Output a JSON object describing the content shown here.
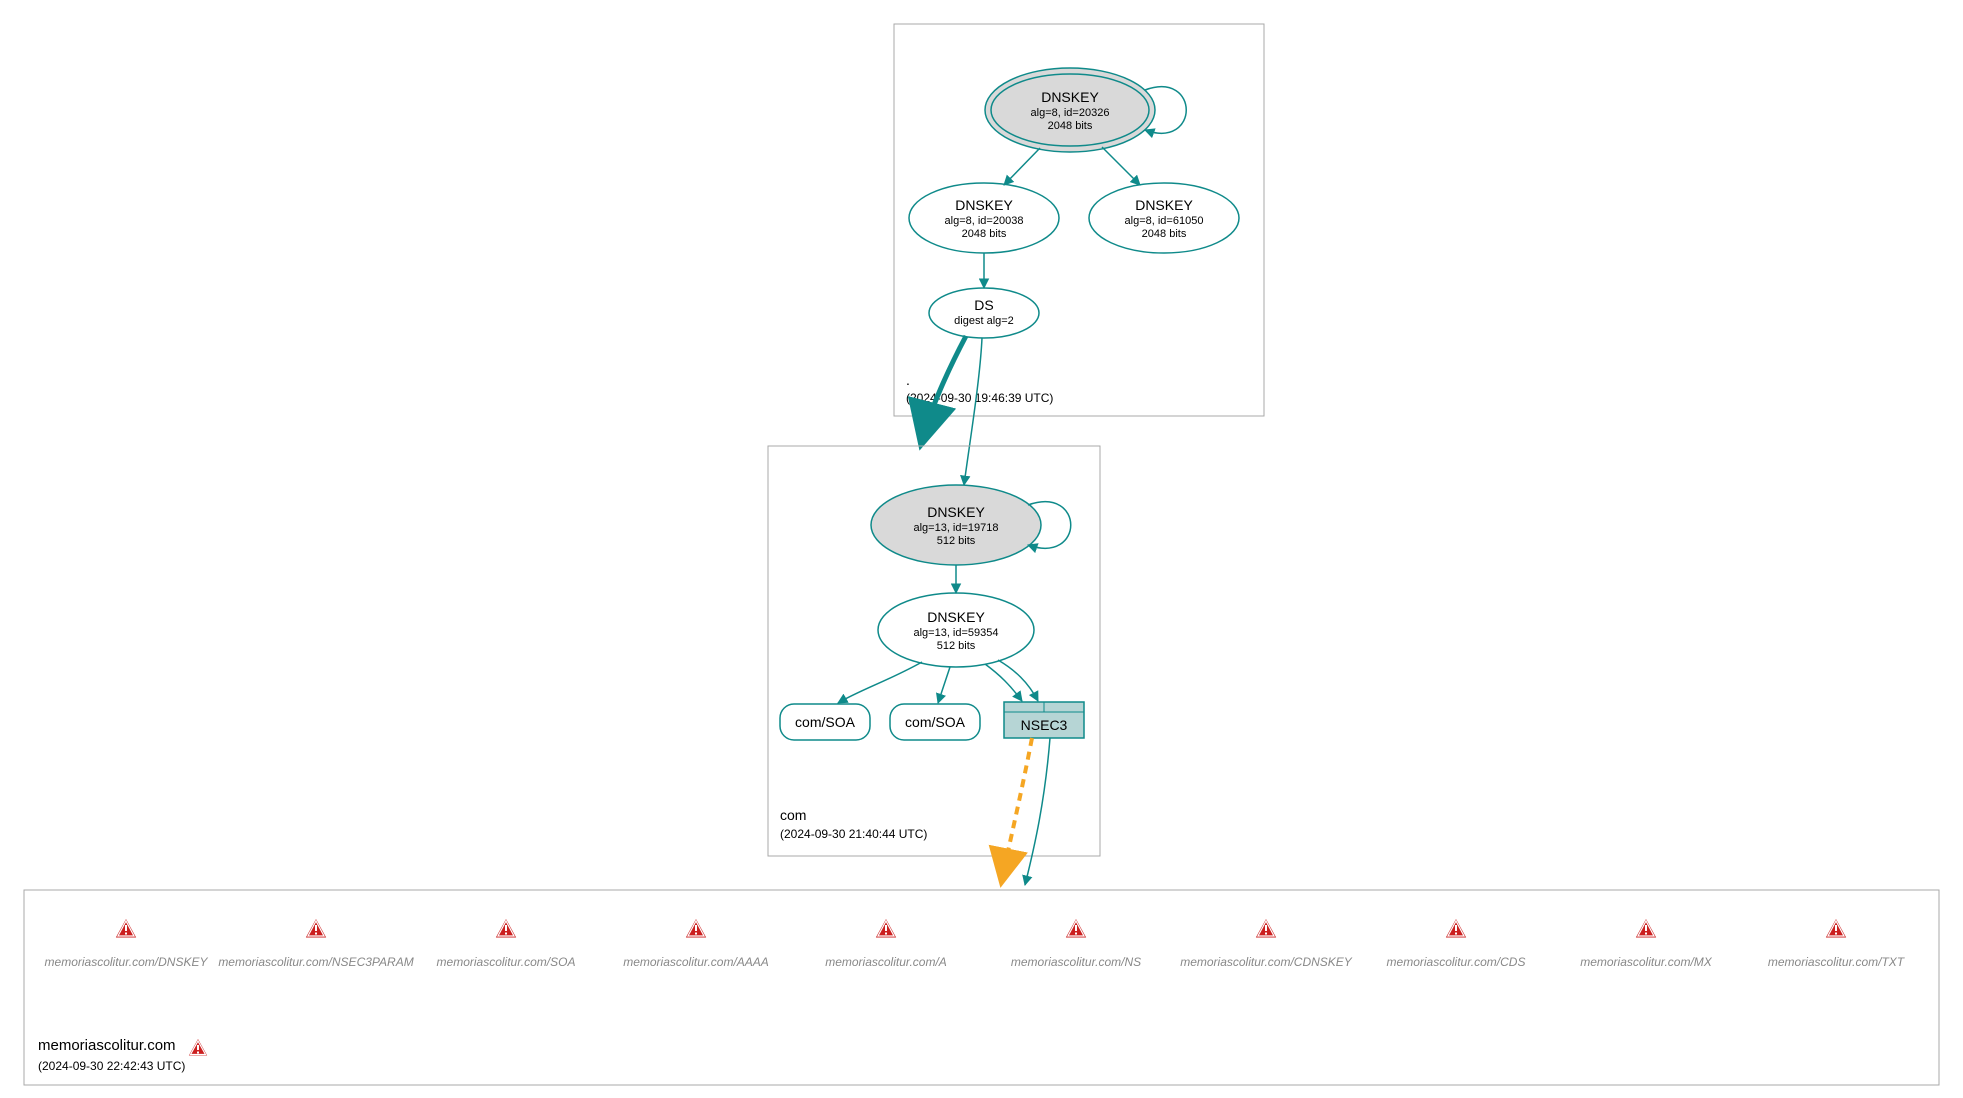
{
  "zones": {
    "root": {
      "label": ".",
      "timestamp": "(2024-09-30 19:46:39 UTC)",
      "nodes": {
        "ksk": {
          "title": "DNSKEY",
          "line1": "alg=8, id=20326",
          "line2": "2048 bits"
        },
        "zsk1": {
          "title": "DNSKEY",
          "line1": "alg=8, id=20038",
          "line2": "2048 bits"
        },
        "zsk2": {
          "title": "DNSKEY",
          "line1": "alg=8, id=61050",
          "line2": "2048 bits"
        },
        "ds": {
          "title": "DS",
          "line1": "digest alg=2"
        }
      }
    },
    "com": {
      "label": "com",
      "timestamp": "(2024-09-30 21:40:44 UTC)",
      "nodes": {
        "ksk": {
          "title": "DNSKEY",
          "line1": "alg=13, id=19718",
          "line2": "512 bits"
        },
        "zsk": {
          "title": "DNSKEY",
          "line1": "alg=13, id=59354",
          "line2": "512 bits"
        },
        "soa1": {
          "title": "com/SOA"
        },
        "soa2": {
          "title": "com/SOA"
        },
        "nsec3": {
          "title": "NSEC3"
        }
      }
    },
    "domain": {
      "label": "memoriascolitur.com",
      "timestamp": "(2024-09-30 22:42:43 UTC)",
      "errors": [
        "memoriascolitur.com/DNSKEY",
        "memoriascolitur.com/NSEC3PARAM",
        "memoriascolitur.com/SOA",
        "memoriascolitur.com/AAAA",
        "memoriascolitur.com/A",
        "memoriascolitur.com/NS",
        "memoriascolitur.com/CDNSKEY",
        "memoriascolitur.com/CDS",
        "memoriascolitur.com/MX",
        "memoriascolitur.com/TXT"
      ]
    }
  },
  "colors": {
    "teal": "#0f8a8a",
    "tealFill": "#d4d4d4",
    "grey": "#a9a9a9",
    "orange": "#f5a623",
    "red": "#cc1f1f"
  }
}
